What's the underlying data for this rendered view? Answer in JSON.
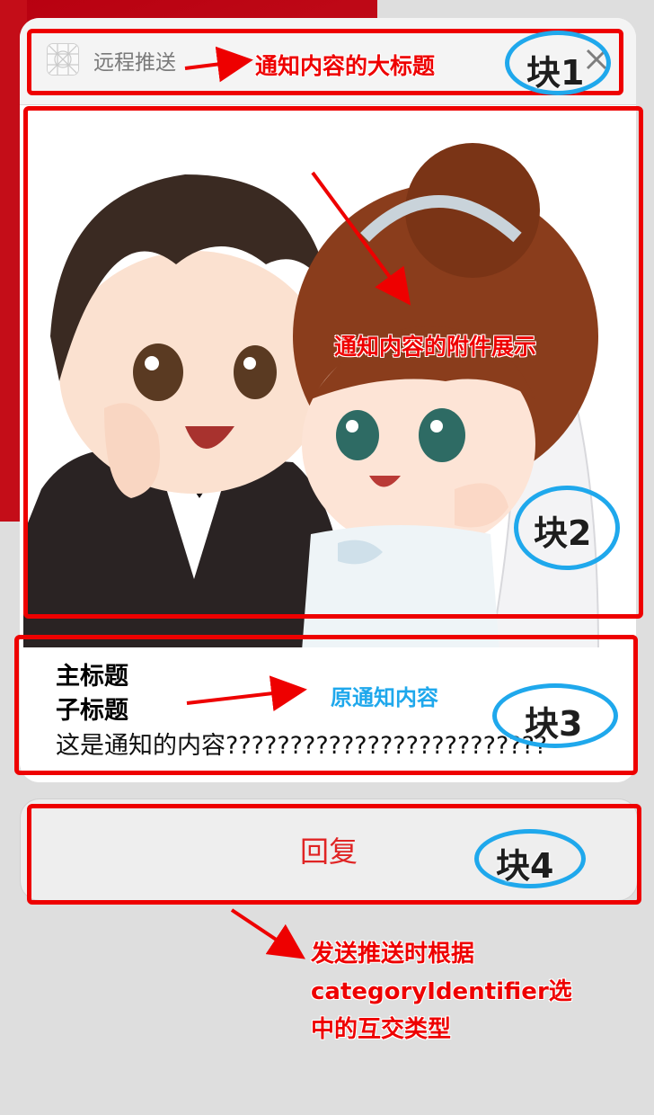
{
  "header": {
    "app_name": "远程推送",
    "icon_name": "app-grid-icon",
    "close_icon": "close-icon"
  },
  "attachment": {
    "description_icon": "wedding-couple-image"
  },
  "content": {
    "main_title": "主标题",
    "sub_title": "子标题",
    "body": "这是通知的内容?????????????????????????"
  },
  "actions": {
    "reply_label": "回复"
  },
  "annotations": {
    "title_note": "通知内容的大标题",
    "attachment_note": "通知内容的附件展示",
    "content_note": "原通知内容",
    "action_note_lines": [
      "发送推送时根据",
      "categoryIdentifier选",
      "中的互交类型"
    ],
    "block1": "块1",
    "block2": "块2",
    "block3": "块3",
    "block4": "块4"
  },
  "colors": {
    "annotation_red": "#ee0000",
    "annotation_blue": "#1fa8ec",
    "reply_text": "#e02424",
    "background": "#dedede"
  }
}
